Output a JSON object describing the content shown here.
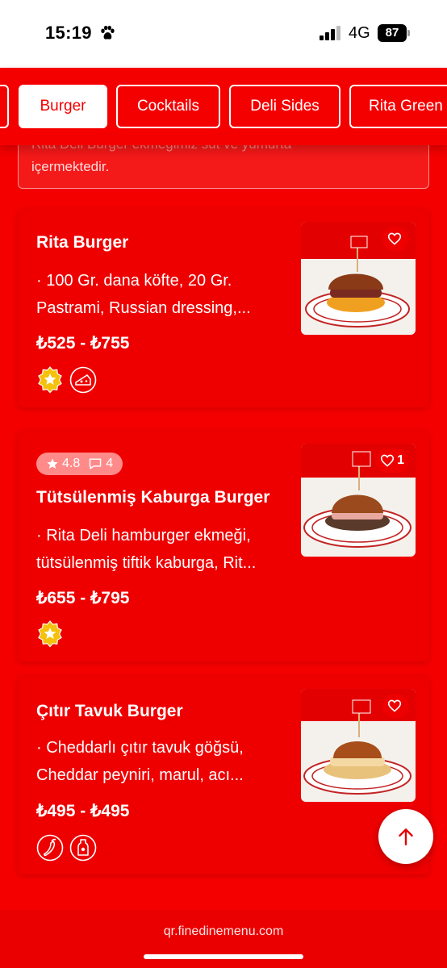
{
  "status_bar": {
    "time": "15:19",
    "network": "4G",
    "battery": "87"
  },
  "tabs": [
    {
      "label": ""
    },
    {
      "label": "Burger",
      "active": true
    },
    {
      "label": "Cocktails"
    },
    {
      "label": "Deli Sides"
    },
    {
      "label": "Rita Green"
    }
  ],
  "note": {
    "line1": "Rita Deli Burger ekmeğimiz süt ve yumurta",
    "line2": "içermektedir."
  },
  "products": [
    {
      "title": "Rita Burger",
      "description": "· 100 Gr. dana köfte, 20 Gr. Pastrami, Russian dressing,...",
      "price": "₺525 - ₺755",
      "favorites": "",
      "badges": [
        "star-badge-icon",
        "cheese-icon"
      ]
    },
    {
      "title": "Tütsülenmiş Kaburga Burger",
      "description": "· Rita Deli hamburger ekmeği, tütsülenmiş tiftik kaburga, Rit...",
      "price": "₺655 - ₺795",
      "rating": "4.8",
      "comments": "4",
      "favorites": "1",
      "badges": [
        "star-badge-icon"
      ]
    },
    {
      "title": "Çıtır Tavuk Burger",
      "description": "· Cheddarlı çıtır tavuk göğsü, Cheddar peyniri, marul, acı...",
      "price": "₺495 - ₺495",
      "favorites": "",
      "badges": [
        "chili-pepper-icon",
        "bottle-icon"
      ]
    }
  ],
  "footer": {
    "url": "qr.finedinemenu.com"
  },
  "colors": {
    "brand_red": "#f50000",
    "badge_gold": "#f5c10a",
    "white": "#ffffff"
  }
}
